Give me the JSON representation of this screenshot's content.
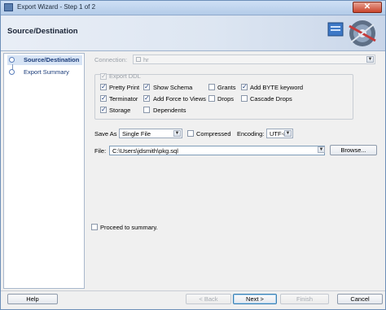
{
  "window": {
    "title": "Export Wizard - Step 1 of 2",
    "close_glyph": "✕"
  },
  "header": {
    "title": "Source/Destination",
    "logo_icon": "sql-developer-logo"
  },
  "sidebar": {
    "items": [
      {
        "label": "Source/Destination",
        "active": true
      },
      {
        "label": "Export Summary",
        "active": false
      }
    ]
  },
  "connection": {
    "label": "Connection:",
    "value": "hr"
  },
  "export_ddl": {
    "label": "Export DDL",
    "options": [
      {
        "label": "Pretty Print",
        "checked": true
      },
      {
        "label": "Show Schema",
        "checked": true
      },
      {
        "label": "Grants",
        "checked": false
      },
      {
        "label": "Add BYTE keyword",
        "checked": true
      },
      {
        "label": "Terminator",
        "checked": true
      },
      {
        "label": "Add Force to Views",
        "checked": true
      },
      {
        "label": "Drops",
        "checked": false
      },
      {
        "label": "Cascade Drops",
        "checked": false
      },
      {
        "label": "Storage",
        "checked": true
      },
      {
        "label": "Dependents",
        "checked": false
      }
    ]
  },
  "save_as": {
    "label": "Save As",
    "value": "Single File"
  },
  "compressed": {
    "label": "Compressed",
    "checked": false
  },
  "encoding": {
    "label": "Encoding:",
    "value": "UTF-8"
  },
  "file": {
    "label": "File:",
    "value": "C:\\Users\\jdsmith\\pkg.sql",
    "browse_label": "Browse..."
  },
  "proceed": {
    "label": "Proceed to summary.",
    "checked": false
  },
  "buttons": {
    "help": "Help",
    "back": "< Back",
    "next": "Next >",
    "finish": "Finish",
    "cancel": "Cancel"
  }
}
